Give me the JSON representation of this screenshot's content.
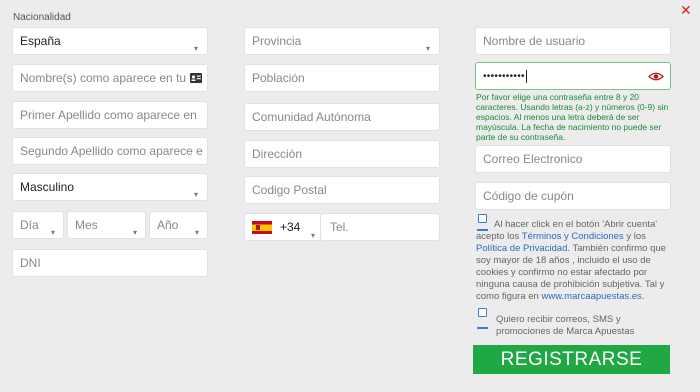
{
  "header": {
    "nacionalidad_label": "Nacionalidad",
    "close_glyph": "✕"
  },
  "col1": {
    "country_value": "España",
    "name_placeholder": "Nombre(s) como aparece en tu D",
    "surname1_placeholder": "Primer Apellido como aparece en",
    "surname2_placeholder": "Segundo Apellido como aparece e",
    "gender_value": "Masculino",
    "day_placeholder": "Día",
    "month_placeholder": "Mes",
    "year_placeholder": "Año",
    "dni_placeholder": "DNI"
  },
  "col2": {
    "province_placeholder": "Provincia",
    "town_placeholder": "Población",
    "community_placeholder": "Comunidad Autónoma",
    "address_placeholder": "Dirección",
    "postal_placeholder": "Codigo Postal",
    "dial_code": "+34",
    "phone_placeholder": "Tel."
  },
  "col3": {
    "username_placeholder": "Nombre de usuario",
    "password_value": "•••••••••••",
    "password_hint": "Por favor elige una contraseña entre 8 y 20 caracteres. Usando letras (a-z) y números (0-9) sin espacios. Al menos una letra deberá de ser mayúscula. La fecha de nacimiento no puede ser parte de su contraseña.",
    "email_placeholder": "Correo Electronico",
    "coupon_placeholder": "Código de cupón",
    "terms_text_1": "Al hacer click en el botón 'Abrir cuenta' acepto los",
    "terms_link": "Términos y Condiciones",
    "terms_text_2": "y los",
    "privacy_link": "Política de Privacidad",
    "terms_text_3": ". También confirmo que soy mayor de 18 años , incluido el uso de cookies y confirmo no estar afectado por ninguna causa de prohibición subjetiva. Tal y como figura en",
    "site_link": "www.marcaapuestas.es",
    "terms_text_4": ".",
    "marketing_text": "Quiero recibir correos, SMS y promociones de Marca Apuestas",
    "register_label": "REGISTRARSE"
  },
  "colors": {
    "accent_green": "#1fa844",
    "hint_green": "#1a8a3a",
    "link_blue": "#2a6bc2",
    "close_red": "#dd2222"
  }
}
